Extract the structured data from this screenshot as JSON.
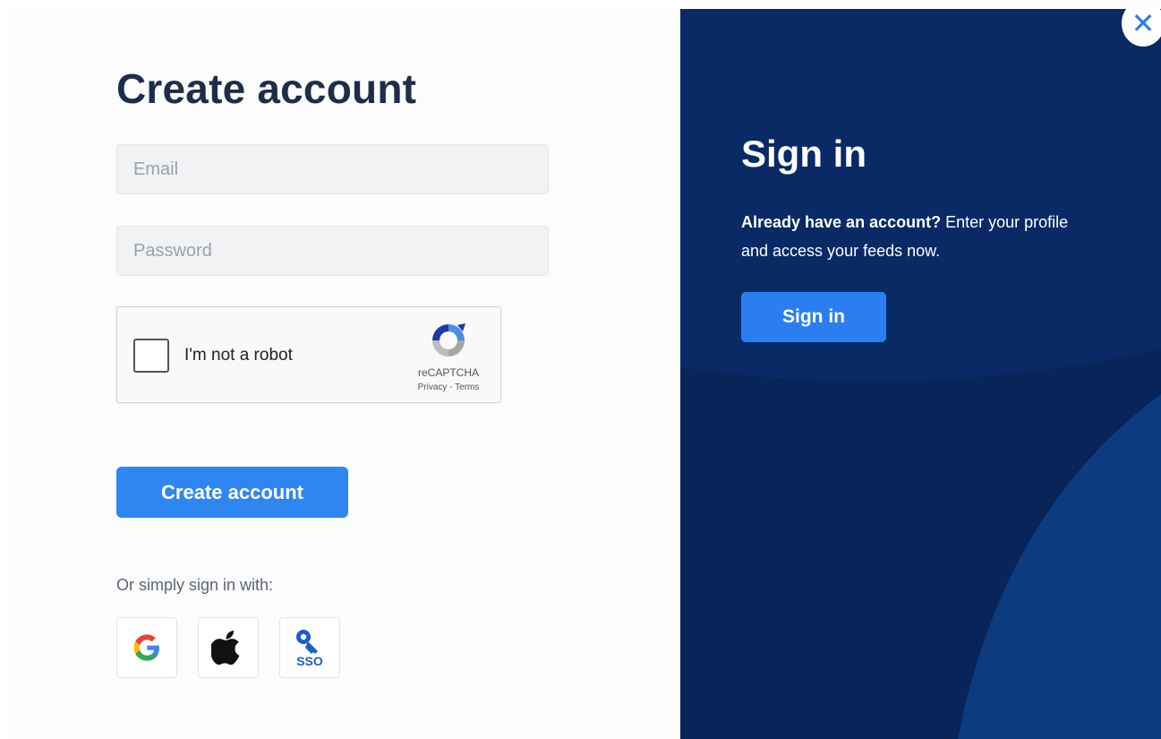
{
  "signup": {
    "title": "Create account",
    "email_placeholder": "Email",
    "password_placeholder": "Password",
    "create_button": "Create account",
    "or_text": "Or simply sign in with:"
  },
  "captcha": {
    "label": "I'm not a robot",
    "brand": "reCAPTCHA",
    "links": "Privacy - Terms",
    "checked": false
  },
  "social": [
    {
      "name": "google",
      "icon": "google-icon"
    },
    {
      "name": "apple",
      "icon": "apple-icon"
    },
    {
      "name": "sso",
      "icon": "sso-icon",
      "label": "SSO"
    }
  ],
  "signin": {
    "title": "Sign in",
    "desc_bold": "Already have an account?",
    "desc_rest": " Enter your profile and access your feeds now.",
    "button": "Sign in"
  },
  "close": {
    "symbol": "✕",
    "icon": "close-icon"
  },
  "colors": {
    "navy_panel": "#0a2a66",
    "panel_curve": "#0c3677",
    "primary_button": "#2f86f0",
    "signin_button": "#2b7ef0",
    "title_text": "#1e2d4a"
  }
}
